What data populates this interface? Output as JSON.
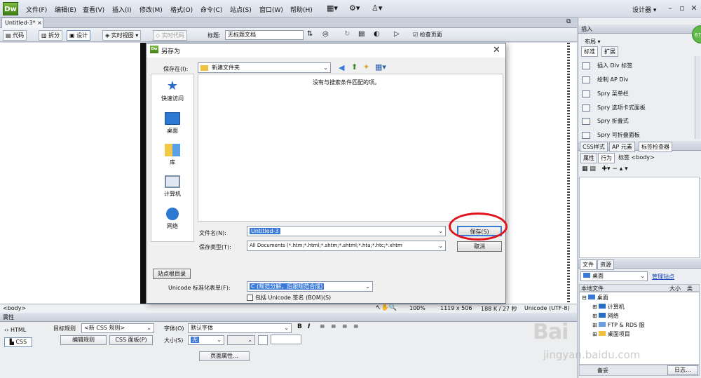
{
  "app": {
    "logo": "Dw"
  },
  "menu": [
    "文件(F)",
    "编辑(E)",
    "查看(V)",
    "插入(I)",
    "修改(M)",
    "格式(O)",
    "命令(C)",
    "站点(S)",
    "窗口(W)",
    "帮助(H)"
  ],
  "workspace": {
    "label": "设计器"
  },
  "doc_tab": {
    "title": "Untitled-3*"
  },
  "toolbar": {
    "code": "代码",
    "split": "拆分",
    "design": "设计",
    "live_view": "实时视图",
    "live_code": "实时代码",
    "title_label": "标题:",
    "title_value": "无标题文档",
    "check_page": "检查页面"
  },
  "statusbar": {
    "tag": "<body>",
    "zoom": "100%",
    "size": "1119 x 506",
    "weight": "188 K / 27 秒",
    "encoding": "Unicode (UTF-8)"
  },
  "properties": {
    "header": "属性",
    "html": "HTML",
    "css": "CSS",
    "target_rule_label": "目标规则",
    "target_rule_value": "<新 CSS 规则>",
    "edit_rule": "编辑规则",
    "css_panel": "CSS 面板(P)",
    "font_label": "字体(O)",
    "font_value": "默认字体",
    "size_label": "大小(S)",
    "size_value": "无",
    "page_props": "页面属性..."
  },
  "right": {
    "insert_header": "插入",
    "layout_label": "布局",
    "tab_standard": "标准",
    "tab_extend": "扩展",
    "insert_items": [
      "插入 Div 标签",
      "绘制 AP Div",
      "Spry 菜单栏",
      "Spry 选项卡式面板",
      "Spry 折叠式",
      "Spry 可折叠面板"
    ],
    "css_tabs": [
      "CSS样式",
      "AP 元素",
      "标签检查器"
    ],
    "attr_tabs": [
      "属性",
      "行为"
    ],
    "tag_label": "标签 <body>",
    "files_tabs": [
      "文件",
      "资源"
    ],
    "site_select": "桌面",
    "manage_site": "管理站点",
    "files_header_local": "本地文件",
    "files_header_size": "大小",
    "files_header_type": "类",
    "files": [
      "桌面",
      "计算机",
      "网络",
      "FTP & RDS 服",
      "桌面项目"
    ],
    "bottom_status": "备妥",
    "log_btn": "日志..."
  },
  "dialog": {
    "title": "另存为",
    "save_in_label": "保存在(I):",
    "save_in_value": "新建文件夹",
    "empty_message": "没有与搜索条件匹配的项。",
    "places": [
      "快速访问",
      "桌面",
      "库",
      "计算机",
      "网络"
    ],
    "filename_label": "文件名(N):",
    "filename_value": "Untitled-3",
    "filetype_label": "保存类型(T):",
    "filetype_value": "All Documents (*.htm;*.html;*.shtm;*.shtml;*.hta;*.htc;*.xhtm",
    "save_btn": "保存(S)",
    "cancel_btn": "取消",
    "site_root": "站点根目录",
    "unicode_label": "Unicode 标准化表单(F):",
    "unicode_value": "C (规范分解，后跟规范合成)",
    "bom_label": "包括 Unicode 签名 (BOM)(S)"
  },
  "watermark": {
    "logo": "Bai",
    "url": "jingyan.baidu.com"
  },
  "avatar_text": "67",
  "colors": {
    "accent": "#3b79d6",
    "annotation": "#e0121c",
    "logo_green": "#5fa82c"
  }
}
